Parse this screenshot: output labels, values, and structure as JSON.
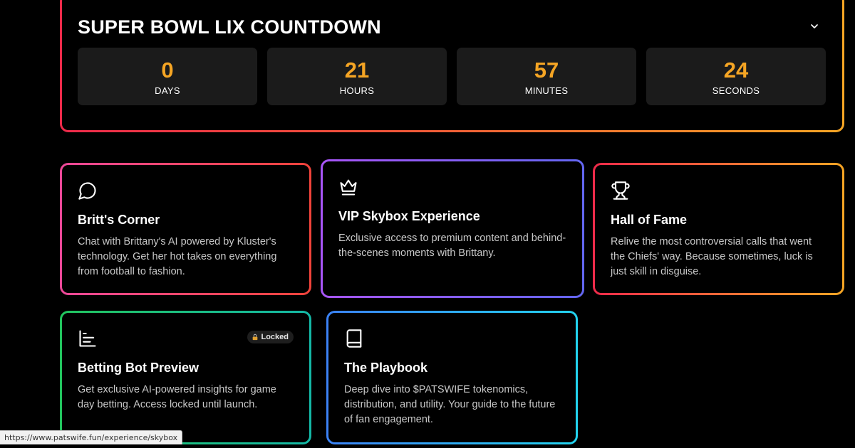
{
  "countdown": {
    "title": "SUPER BOWL LIX COUNTDOWN",
    "chevron_icon": "chevron-down-icon",
    "units": [
      {
        "value": "0",
        "label": "DAYS"
      },
      {
        "value": "21",
        "label": "HOURS"
      },
      {
        "value": "57",
        "label": "MINUTES"
      },
      {
        "value": "24",
        "label": "SECONDS"
      }
    ],
    "accent": "#f5a524"
  },
  "cards": [
    {
      "icon": "chat-bubble-icon",
      "title": "Britt's Corner",
      "description": "Chat with Brittany's AI powered by Kluster's technology. Get her hot takes on everything from football to fashion."
    },
    {
      "icon": "crown-icon",
      "title": "VIP Skybox Experience",
      "description": "Exclusive access to premium content and behind-the-scenes moments with Brittany."
    },
    {
      "icon": "trophy-icon",
      "title": "Hall of Fame",
      "description": "Relive the most controversial calls that went the Chiefs' way. Because sometimes, luck is just skill in disguise."
    },
    {
      "icon": "bar-chart-icon",
      "title": "Betting Bot Preview",
      "description": "Get exclusive AI-powered insights for game day betting. Access locked until launch.",
      "badge": "Locked",
      "badge_icon": "lock-icon"
    },
    {
      "icon": "book-icon",
      "title": "The Playbook",
      "description": "Deep dive into $PATSWIFE tokenomics, distribution, and utility. Your guide to the future of fan engagement."
    }
  ],
  "status_bar": {
    "url": "https://www.patswife.fun/experience/skybox"
  }
}
